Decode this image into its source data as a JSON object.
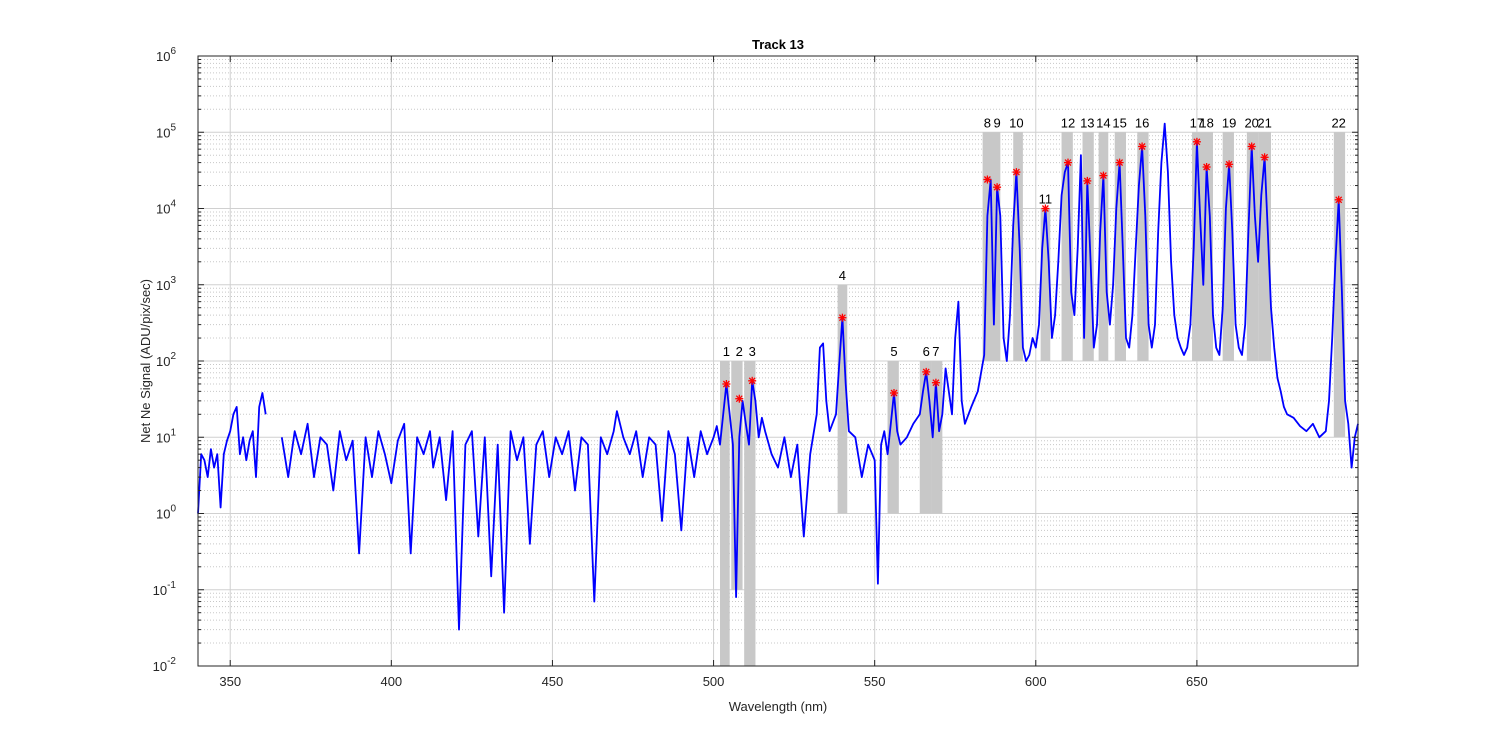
{
  "chart_data": {
    "type": "line",
    "title": "Track 13",
    "xlabel": "Wavelength (nm)",
    "ylabel": "Net Ne Signal (ADU/pix/sec)",
    "xlim": [
      340,
      700
    ],
    "ylim": [
      0.01,
      1000000
    ],
    "yscale": "log",
    "grid": true,
    "x_ticks": [
      "350",
      "400",
      "450",
      "500",
      "550",
      "600",
      "650"
    ],
    "x_tick_values": [
      350,
      400,
      450,
      500,
      550,
      600,
      650
    ],
    "y_tick_exponents": [
      "-2",
      "-1",
      "0",
      "1",
      "2",
      "3",
      "4",
      "5",
      "6"
    ],
    "y_tick_base": "10",
    "colors": {
      "line": "#0000ff",
      "marker": "#ff0000",
      "band": "#c8c8c8",
      "grid": "#d0d0d0"
    },
    "series": [
      {
        "points": [
          [
            340,
            1
          ],
          [
            341,
            6
          ],
          [
            342,
            5
          ],
          [
            343,
            3
          ],
          [
            344,
            7
          ],
          [
            345,
            4
          ],
          [
            346,
            6
          ],
          [
            347,
            1.2
          ],
          [
            348,
            6
          ],
          [
            349,
            9
          ],
          [
            350,
            12
          ],
          [
            351,
            20
          ],
          [
            352,
            25
          ],
          [
            353,
            6
          ],
          [
            354,
            10
          ],
          [
            355,
            5
          ],
          [
            356,
            9
          ],
          [
            357,
            12
          ],
          [
            358,
            3
          ],
          [
            359,
            25
          ],
          [
            360,
            38
          ],
          [
            361,
            20
          ],
          [
            366,
            10
          ],
          [
            368,
            3
          ],
          [
            370,
            12
          ],
          [
            372,
            6
          ],
          [
            374,
            15
          ],
          [
            376,
            3
          ],
          [
            378,
            10
          ],
          [
            380,
            8
          ],
          [
            382,
            2
          ],
          [
            384,
            12
          ],
          [
            386,
            5
          ],
          [
            388,
            9
          ],
          [
            390,
            0.3
          ],
          [
            392,
            10
          ],
          [
            394,
            3
          ],
          [
            396,
            12
          ],
          [
            398,
            6
          ],
          [
            400,
            2.5
          ],
          [
            402,
            9
          ],
          [
            404,
            15
          ],
          [
            406,
            0.3
          ],
          [
            408,
            10
          ],
          [
            410,
            6
          ],
          [
            412,
            12
          ],
          [
            413,
            4
          ],
          [
            415,
            10
          ],
          [
            417,
            1.5
          ],
          [
            419,
            12
          ],
          [
            421,
            0.03
          ],
          [
            423,
            8
          ],
          [
            425,
            12
          ],
          [
            427,
            0.5
          ],
          [
            429,
            10
          ],
          [
            431,
            0.15
          ],
          [
            433,
            8
          ],
          [
            435,
            0.05
          ],
          [
            437,
            12
          ],
          [
            439,
            5
          ],
          [
            441,
            10
          ],
          [
            443,
            0.4
          ],
          [
            445,
            8
          ],
          [
            447,
            12
          ],
          [
            449,
            3
          ],
          [
            451,
            10
          ],
          [
            453,
            6
          ],
          [
            455,
            12
          ],
          [
            457,
            2
          ],
          [
            459,
            10
          ],
          [
            461,
            8
          ],
          [
            463,
            0.07
          ],
          [
            465,
            10
          ],
          [
            467,
            6
          ],
          [
            469,
            12
          ],
          [
            470,
            22
          ],
          [
            472,
            10
          ],
          [
            474,
            6
          ],
          [
            476,
            12
          ],
          [
            478,
            3
          ],
          [
            480,
            10
          ],
          [
            482,
            8
          ],
          [
            484,
            0.8
          ],
          [
            486,
            12
          ],
          [
            488,
            6
          ],
          [
            490,
            0.6
          ],
          [
            492,
            10
          ],
          [
            494,
            3
          ],
          [
            496,
            12
          ],
          [
            498,
            6
          ],
          [
            500,
            10
          ],
          [
            501,
            14
          ],
          [
            502,
            8
          ],
          [
            503,
            20
          ],
          [
            504,
            50
          ],
          [
            505,
            20
          ],
          [
            506,
            8
          ],
          [
            507,
            0.08
          ],
          [
            508,
            10
          ],
          [
            509,
            30
          ],
          [
            510,
            15
          ],
          [
            511,
            8
          ],
          [
            512,
            55
          ],
          [
            513,
            30
          ],
          [
            514,
            10
          ],
          [
            515,
            18
          ],
          [
            516,
            12
          ],
          [
            518,
            6
          ],
          [
            520,
            4
          ],
          [
            522,
            10
          ],
          [
            524,
            3
          ],
          [
            526,
            8
          ],
          [
            528,
            0.5
          ],
          [
            530,
            6
          ],
          [
            532,
            20
          ],
          [
            533,
            150
          ],
          [
            534,
            170
          ],
          [
            535,
            30
          ],
          [
            536,
            12
          ],
          [
            538,
            20
          ],
          [
            539,
            90
          ],
          [
            540,
            370
          ],
          [
            541,
            50
          ],
          [
            542,
            12
          ],
          [
            544,
            10
          ],
          [
            546,
            3
          ],
          [
            548,
            8
          ],
          [
            550,
            5
          ],
          [
            551,
            0.12
          ],
          [
            552,
            8
          ],
          [
            553,
            12
          ],
          [
            554,
            6
          ],
          [
            555,
            15
          ],
          [
            556,
            38
          ],
          [
            557,
            12
          ],
          [
            558,
            8
          ],
          [
            560,
            10
          ],
          [
            562,
            15
          ],
          [
            564,
            20
          ],
          [
            565,
            40
          ],
          [
            566,
            72
          ],
          [
            567,
            30
          ],
          [
            568,
            10
          ],
          [
            569,
            52
          ],
          [
            570,
            12
          ],
          [
            571,
            20
          ],
          [
            572,
            80
          ],
          [
            573,
            40
          ],
          [
            574,
            20
          ],
          [
            575,
            200
          ],
          [
            576,
            600
          ],
          [
            577,
            30
          ],
          [
            578,
            15
          ],
          [
            580,
            25
          ],
          [
            582,
            40
          ],
          [
            584,
            120
          ],
          [
            585,
            8000
          ],
          [
            586,
            24000
          ],
          [
            587,
            300
          ],
          [
            588,
            19000
          ],
          [
            589,
            8000
          ],
          [
            590,
            200
          ],
          [
            591,
            100
          ],
          [
            592,
            400
          ],
          [
            593,
            6000
          ],
          [
            594,
            30000
          ],
          [
            595,
            3000
          ],
          [
            596,
            150
          ],
          [
            597,
            100
          ],
          [
            598,
            120
          ],
          [
            599,
            200
          ],
          [
            600,
            150
          ],
          [
            601,
            300
          ],
          [
            602,
            3000
          ],
          [
            603,
            10000
          ],
          [
            604,
            2000
          ],
          [
            605,
            200
          ],
          [
            606,
            400
          ],
          [
            607,
            2000
          ],
          [
            608,
            15000
          ],
          [
            609,
            30000
          ],
          [
            610,
            40000
          ],
          [
            611,
            800
          ],
          [
            612,
            400
          ],
          [
            613,
            3000
          ],
          [
            614,
            50000
          ],
          [
            615,
            200
          ],
          [
            616,
            23000
          ],
          [
            617,
            2000
          ],
          [
            618,
            150
          ],
          [
            619,
            300
          ],
          [
            620,
            5000
          ],
          [
            621,
            27000
          ],
          [
            622,
            800
          ],
          [
            623,
            300
          ],
          [
            624,
            1000
          ],
          [
            625,
            10000
          ],
          [
            626,
            40000
          ],
          [
            627,
            3000
          ],
          [
            628,
            200
          ],
          [
            629,
            150
          ],
          [
            630,
            400
          ],
          [
            631,
            3000
          ],
          [
            632,
            20000
          ],
          [
            633,
            65000
          ],
          [
            634,
            8000
          ],
          [
            635,
            300
          ],
          [
            636,
            150
          ],
          [
            637,
            300
          ],
          [
            638,
            5000
          ],
          [
            639,
            40000
          ],
          [
            640,
            130000
          ],
          [
            641,
            30000
          ],
          [
            642,
            2000
          ],
          [
            643,
            400
          ],
          [
            644,
            200
          ],
          [
            645,
            150
          ],
          [
            646,
            120
          ],
          [
            647,
            150
          ],
          [
            648,
            300
          ],
          [
            649,
            3000
          ],
          [
            650,
            75000
          ],
          [
            651,
            8000
          ],
          [
            652,
            1000
          ],
          [
            653,
            35000
          ],
          [
            654,
            8000
          ],
          [
            655,
            400
          ],
          [
            656,
            150
          ],
          [
            657,
            120
          ],
          [
            658,
            500
          ],
          [
            659,
            10000
          ],
          [
            660,
            38000
          ],
          [
            661,
            5000
          ],
          [
            662,
            300
          ],
          [
            663,
            150
          ],
          [
            664,
            120
          ],
          [
            665,
            300
          ],
          [
            666,
            5000
          ],
          [
            667,
            65000
          ],
          [
            668,
            8000
          ],
          [
            669,
            2000
          ],
          [
            670,
            15000
          ],
          [
            671,
            47000
          ],
          [
            672,
            5000
          ],
          [
            673,
            500
          ],
          [
            674,
            150
          ],
          [
            675,
            60
          ],
          [
            676,
            40
          ],
          [
            677,
            25
          ],
          [
            678,
            20
          ],
          [
            680,
            18
          ],
          [
            682,
            14
          ],
          [
            684,
            12
          ],
          [
            686,
            15
          ],
          [
            688,
            10
          ],
          [
            690,
            12
          ],
          [
            691,
            30
          ],
          [
            692,
            200
          ],
          [
            693,
            2000
          ],
          [
            694,
            13000
          ],
          [
            695,
            800
          ],
          [
            696,
            30
          ],
          [
            697,
            15
          ],
          [
            698,
            4
          ],
          [
            699,
            10
          ],
          [
            700,
            15
          ]
        ]
      }
    ],
    "peaks": [
      {
        "label": "1",
        "x": 504,
        "y": 50
      },
      {
        "label": "2",
        "x": 508,
        "y": 32
      },
      {
        "label": "3",
        "x": 512,
        "y": 55
      },
      {
        "label": "4",
        "x": 540,
        "y": 370
      },
      {
        "label": "5",
        "x": 556,
        "y": 38
      },
      {
        "label": "6",
        "x": 566,
        "y": 72
      },
      {
        "label": "7",
        "x": 569,
        "y": 52
      },
      {
        "label": "8",
        "x": 585,
        "y": 24000
      },
      {
        "label": "9",
        "x": 588,
        "y": 19000
      },
      {
        "label": "10",
        "x": 594,
        "y": 30000
      },
      {
        "label": "11",
        "x": 603,
        "y": 10000
      },
      {
        "label": "12",
        "x": 610,
        "y": 40000
      },
      {
        "label": "13",
        "x": 616,
        "y": 23000
      },
      {
        "label": "14",
        "x": 621,
        "y": 27000
      },
      {
        "label": "15",
        "x": 626,
        "y": 40000
      },
      {
        "label": "16",
        "x": 633,
        "y": 65000
      },
      {
        "label": "17",
        "x": 650,
        "y": 75000
      },
      {
        "label": "18",
        "x": 653,
        "y": 35000
      },
      {
        "label": "19",
        "x": 660,
        "y": 38000
      },
      {
        "label": "20",
        "x": 667,
        "y": 65000
      },
      {
        "label": "21",
        "x": 671,
        "y": 47000
      },
      {
        "label": "22",
        "x": 694,
        "y": 13000
      }
    ],
    "bands": [
      {
        "x0": 502,
        "x1": 505,
        "y0": 0.01,
        "y1": 100
      },
      {
        "x0": 505.5,
        "x1": 509,
        "y0": 0.1,
        "y1": 100
      },
      {
        "x0": 509.5,
        "x1": 513,
        "y0": 0.01,
        "y1": 100
      },
      {
        "x0": 538.5,
        "x1": 541.5,
        "y0": 1,
        "y1": 1000
      },
      {
        "x0": 554,
        "x1": 557.5,
        "y0": 1,
        "y1": 100
      },
      {
        "x0": 564,
        "x1": 567.5,
        "y0": 1,
        "y1": 100
      },
      {
        "x0": 567.5,
        "x1": 571,
        "y0": 1,
        "y1": 100
      },
      {
        "x0": 583.5,
        "x1": 589,
        "y0": 100,
        "y1": 100000
      },
      {
        "x0": 593,
        "x1": 596,
        "y0": 100,
        "y1": 100000
      },
      {
        "x0": 601.5,
        "x1": 604.5,
        "y0": 100,
        "y1": 10000
      },
      {
        "x0": 608,
        "x1": 611.5,
        "y0": 100,
        "y1": 100000
      },
      {
        "x0": 614.5,
        "x1": 618,
        "y0": 100,
        "y1": 100000
      },
      {
        "x0": 619.5,
        "x1": 622.5,
        "y0": 100,
        "y1": 100000
      },
      {
        "x0": 624.5,
        "x1": 628,
        "y0": 100,
        "y1": 100000
      },
      {
        "x0": 631.5,
        "x1": 635,
        "y0": 100,
        "y1": 100000
      },
      {
        "x0": 648.5,
        "x1": 655,
        "y0": 100,
        "y1": 100000
      },
      {
        "x0": 658,
        "x1": 661.5,
        "y0": 100,
        "y1": 100000
      },
      {
        "x0": 665.5,
        "x1": 669,
        "y0": 100,
        "y1": 100000
      },
      {
        "x0": 669,
        "x1": 673,
        "y0": 100,
        "y1": 100000
      },
      {
        "x0": 692.5,
        "x1": 696,
        "y0": 10,
        "y1": 100000
      }
    ]
  }
}
